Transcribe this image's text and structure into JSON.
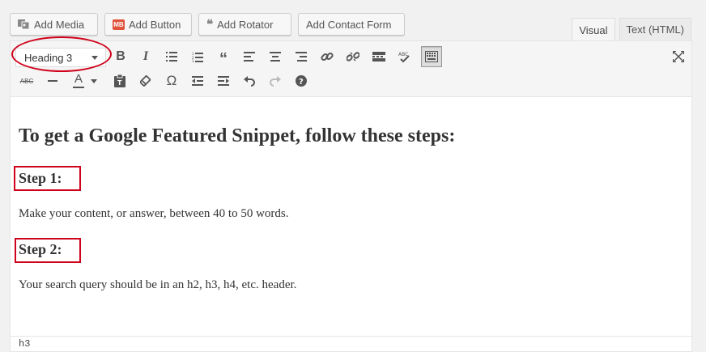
{
  "media_buttons": [
    {
      "label": "Add Media",
      "icon": "media-icon"
    },
    {
      "label": "Add Button",
      "icon": "mb-icon",
      "badge": "MB"
    },
    {
      "label": "Add Rotator",
      "icon": "quote-icon"
    },
    {
      "label": "Add Contact Form",
      "icon": ""
    }
  ],
  "tabs": {
    "visual": "Visual",
    "text": "Text (HTML)"
  },
  "toolbar": {
    "format_select_value": "Heading 3",
    "row1_icons": [
      "bold-icon",
      "italic-icon",
      "bullet-list-icon",
      "numbered-list-icon",
      "blockquote-icon",
      "align-left-icon",
      "align-center-icon",
      "align-right-icon",
      "link-icon",
      "unlink-icon",
      "read-more-icon",
      "spellcheck-icon",
      "toolbar-toggle-icon"
    ],
    "row2_icons": [
      "strikethrough-icon",
      "horizontal-line-icon",
      "text-color-icon",
      "paste-text-icon",
      "clear-formatting-icon",
      "special-character-icon",
      "outdent-icon",
      "indent-icon",
      "undo-icon",
      "redo-icon",
      "help-icon"
    ],
    "fullscreen_icon": "fullscreen-icon",
    "bold_glyph": "B",
    "italic_glyph": "I",
    "omega_glyph": "Ω",
    "color_glyph": "A",
    "abc_glyph": "ABC"
  },
  "content": {
    "heading": "To get a Google Featured Snippet, follow these steps:",
    "step1": "Step 1:",
    "para1": "Make your content, or answer, between 40 to 50 words.",
    "step2": "Step 2:",
    "para2": "Your search query should be in an h2, h3, h4, etc. header."
  },
  "status_path": "h3",
  "colors": {
    "highlight": "#d0021b",
    "toolbar_bg": "#f5f5f5",
    "mb_badge": "#e0533a"
  }
}
